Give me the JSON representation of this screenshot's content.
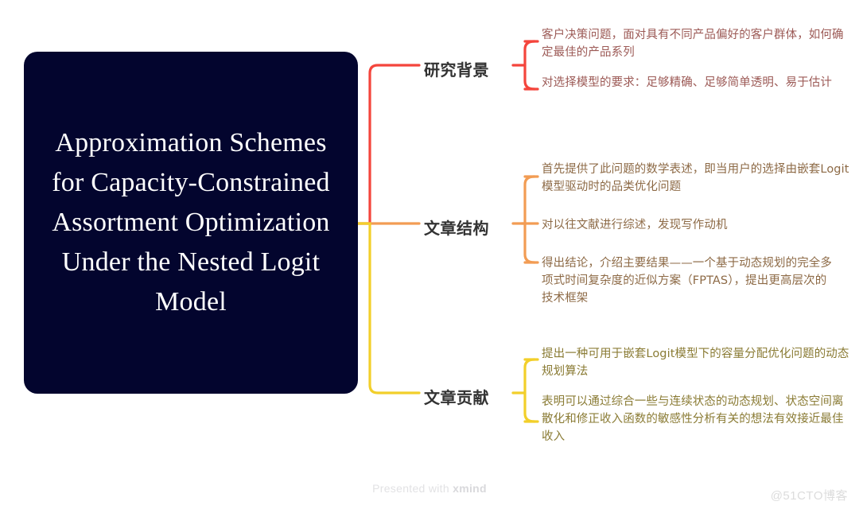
{
  "root": {
    "title": "Approximation Schemes for Capacity-Constrained Assortment Optimization Under the Nested Logit Model",
    "background_color": "#03052e",
    "text_color": "#ffffff"
  },
  "branches": [
    {
      "label": "研究背景",
      "color": "#f4453c",
      "text_color": "#9c5a56",
      "children": [
        "客户决策问题，面对具有不同产品偏好的客户群体，如何确定最佳的产品系列",
        "对选择模型的要求：足够精确、足够简单透明、易于估计"
      ]
    },
    {
      "label": "文章结构",
      "color": "#f29c53",
      "text_color": "#8d6a46",
      "children": [
        "首先提供了此问题的数学表述，即当用户的选择由嵌套Logit模型驱动时的品类优化问题",
        "对以往文献进行综述，发现写作动机",
        "得出结论，介绍主要结果——一个基于动态规划的完全多项式时间复杂度的近似方案（FPTAS），提出更高层次的技术框架"
      ]
    },
    {
      "label": "文章贡献",
      "color": "#f2cf2a",
      "text_color": "#8a7b34",
      "children": [
        "提出一种可用于嵌套Logit模型下的容量分配优化问题的动态规划算法",
        "表明可以通过综合一些与连续状态的动态规划、状态空间离散化和修正收入函数的敏感性分析有关的想法有效接近最佳收入"
      ]
    }
  ],
  "footer": {
    "credit_prefix": "Presented with ",
    "credit_brand": "xmind",
    "watermark": "@51CTO博客"
  },
  "canvas": {
    "background_color": "#ffffff"
  }
}
